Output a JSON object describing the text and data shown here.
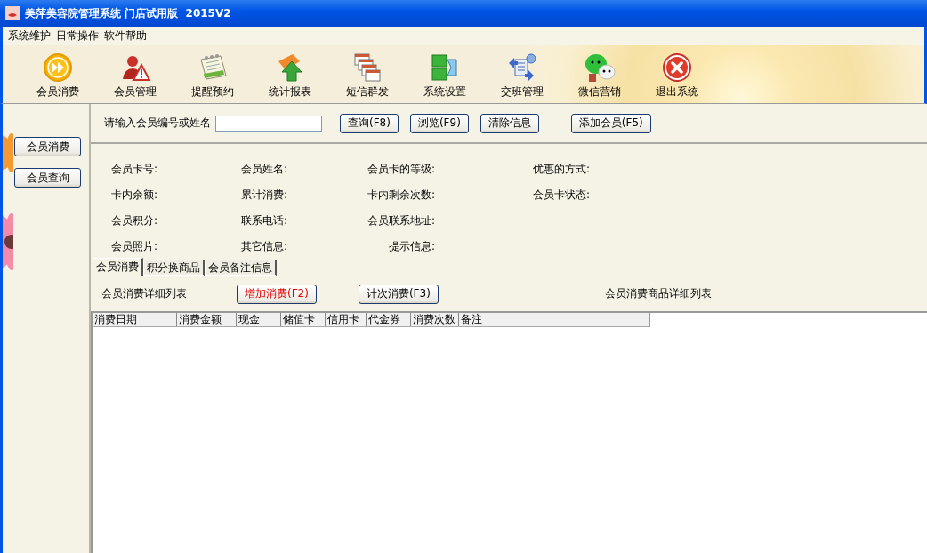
{
  "window": {
    "title": "美萍美容院管理系统 门店试用版  2015V2"
  },
  "menu": [
    "系统维护",
    "日常操作",
    "软件帮助"
  ],
  "toolbar": [
    "会员消费",
    "会员管理",
    "提醒预约",
    "统计报表",
    "短信群发",
    "系统设置",
    "交班管理",
    "微信营销",
    "退出系统"
  ],
  "sidebar": [
    "会员消费",
    "会员查询"
  ],
  "search": {
    "label": "请输入会员编号或姓名",
    "buttons": [
      "查询(F8)",
      "浏览(F9)",
      "清除信息"
    ],
    "add_button": "添加会员(F5)"
  },
  "info_rows": [
    [
      "会员卡号:",
      "会员姓名:",
      "会员卡的等级:",
      "优惠的方式:"
    ],
    [
      "卡内余额:",
      "累计消费:",
      "卡内剩余次数:",
      "会员卡状态:"
    ],
    [
      "会员积分:",
      "联系电话:",
      "会员联系地址:"
    ],
    [
      "会员照片:",
      "其它信息:",
      "提示信息:"
    ]
  ],
  "tabs": [
    {
      "label": "会员消费",
      "selected": true
    },
    {
      "label": "积分换商品",
      "selected": false
    },
    {
      "label": "会员备注信息",
      "selected": false
    }
  ],
  "consume": {
    "list_title": "会员消费详细列表",
    "buttons": [
      {
        "label": "增加消费(F2)",
        "highlight": true
      },
      {
        "label": "计次消费(F3)",
        "highlight": false
      }
    ],
    "goods_title": "会员消费商品详细列表"
  },
  "table": {
    "columns": [
      "消费日期",
      "消费金额",
      "现金",
      "储值卡",
      "信用卡",
      "代金券",
      "消费次数",
      "备注"
    ]
  }
}
